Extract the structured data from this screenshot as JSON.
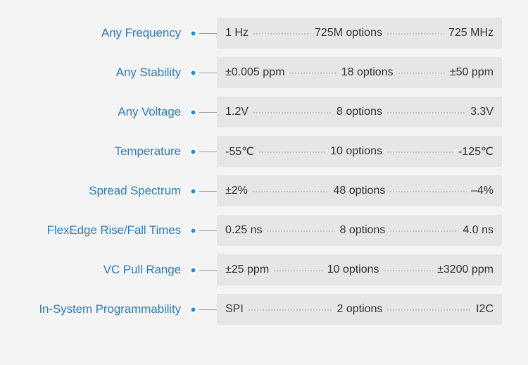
{
  "widget": {
    "name": "specification-range-table",
    "colors": {
      "background": "#f4f4f4",
      "bar_fill": "#e6e6e6",
      "label_text": "#2e7cb8",
      "value_text": "#333333",
      "marker_ring": "#1a8fe0",
      "marker_center": "#ffffff",
      "leader_dots": "#b9b9b9",
      "connector_line": "#9b9b9b"
    }
  },
  "rows": [
    {
      "label": "Any Frequency",
      "min": "1 Hz",
      "options": "725M options",
      "max": "725 MHz"
    },
    {
      "label": "Any Stability",
      "min": "±0.005 ppm",
      "options": "18 options",
      "max": "±50 ppm"
    },
    {
      "label": "Any Voltage",
      "min": "1.2V",
      "options": "8 options",
      "max": "3.3V"
    },
    {
      "label": "Temperature",
      "min": "-55℃",
      "options": "10 options",
      "max": "-125℃"
    },
    {
      "label": "Spread Spectrum",
      "min": "±2%",
      "options": "48 options",
      "max": "–4%"
    },
    {
      "label": "FlexEdge Rise/Fall Times",
      "min": "0.25 ns",
      "options": "8 options",
      "max": "4.0 ns"
    },
    {
      "label": "VC Pull Range",
      "min": "±25 ppm",
      "options": "10 options",
      "max": "±3200 ppm"
    },
    {
      "label": "In-System Programmability",
      "min": "SPI",
      "options": "2 options",
      "max": "I2C"
    }
  ]
}
